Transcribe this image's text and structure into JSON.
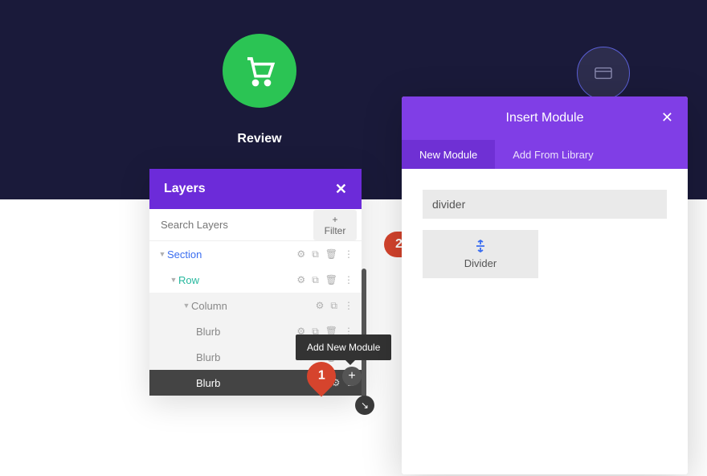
{
  "review": {
    "label": "Review"
  },
  "layers": {
    "title": "Layers",
    "search_placeholder": "Search Layers",
    "filter_label": "Filter",
    "items": {
      "section": "Section",
      "row": "Row",
      "column": "Column",
      "blurb1": "Blurb",
      "blurb2": "Blurb",
      "blurb3": "Blurb"
    }
  },
  "tooltip": {
    "text": "Add New Module"
  },
  "badges": {
    "one": "1",
    "two": "2"
  },
  "insert": {
    "title": "Insert Module",
    "tabs": {
      "new": "New Module",
      "library": "Add From Library"
    },
    "search_value": "divider",
    "module": {
      "divider": "Divider"
    }
  }
}
